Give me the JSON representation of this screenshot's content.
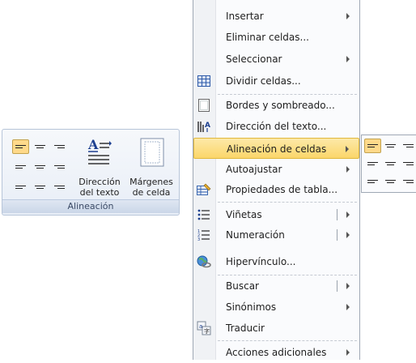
{
  "ribbon": {
    "direction_label": "Dirección del texto",
    "margins_label": "Márgenes de celda",
    "group_caption": "Alineación",
    "icons": {
      "align_buttons": "align-icon",
      "direction": "text-direction-icon",
      "margins": "cell-margins-icon"
    }
  },
  "menu": {
    "items": [
      {
        "label": "Insertar",
        "icon": "",
        "arrow": true
      },
      {
        "label": "Eliminar celdas...",
        "icon": ""
      },
      {
        "label": "Seleccionar",
        "icon": "",
        "arrow": true
      },
      {
        "label": "Dividir celdas...",
        "icon": "split-cells-icon"
      },
      {
        "label": "Bordes y sombreado...",
        "icon": "borders-icon"
      },
      {
        "label": "Dirección del texto...",
        "icon": "text-direction-icon"
      },
      {
        "label": "Alineación de celdas",
        "icon": "",
        "arrow": true,
        "highlighted": true
      },
      {
        "label": "Autoajustar",
        "icon": "",
        "arrow": true
      },
      {
        "label": "Propiedades de tabla...",
        "icon": "table-properties-icon"
      },
      {
        "label": "Viñetas",
        "icon": "bullets-icon",
        "split_arrow": true
      },
      {
        "label": "Numeración",
        "icon": "numbering-icon",
        "split_arrow": true
      },
      {
        "label": "Hipervínculo...",
        "icon": "hyperlink-icon"
      },
      {
        "label": "Buscar",
        "icon": "",
        "split_arrow": true
      },
      {
        "label": "Sinónimos",
        "icon": "",
        "arrow": true
      },
      {
        "label": "Traducir",
        "icon": "translate-icon"
      },
      {
        "label": "Acciones adicionales",
        "icon": "",
        "arrow": true
      }
    ]
  },
  "colors": {
    "highlight": "#fbd66a",
    "active_button": "#ffd98a",
    "ribbon_border": "#b7c5d9"
  }
}
